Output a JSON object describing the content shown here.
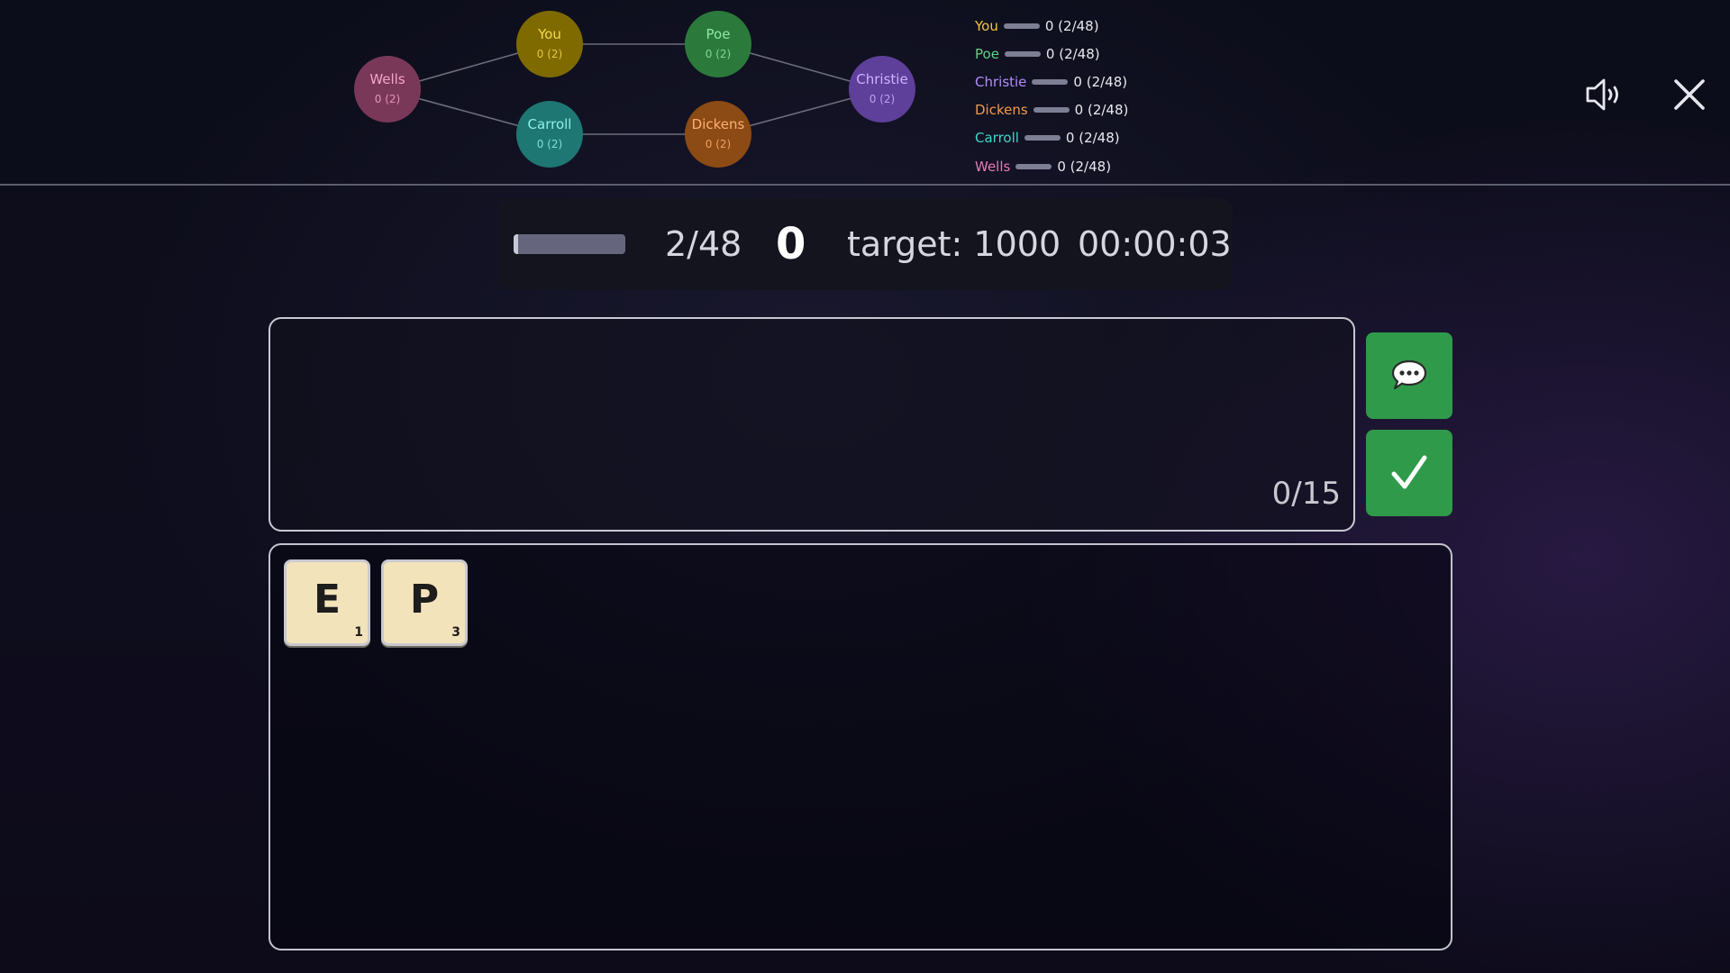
{
  "network": {
    "nodes": [
      {
        "id": "you",
        "name": "You",
        "score": "0 (2)",
        "fill": "#7f6a00",
        "text": "#f6d84a"
      },
      {
        "id": "poe",
        "name": "Poe",
        "score": "0 (2)",
        "fill": "#2b7a3b",
        "text": "#8ee7a3"
      },
      {
        "id": "christie",
        "name": "Christie",
        "score": "0 (2)",
        "fill": "#5e3f9a",
        "text": "#cfb4ff"
      },
      {
        "id": "dickens",
        "name": "Dickens",
        "score": "0 (2)",
        "fill": "#8c4a14",
        "text": "#ffb072"
      },
      {
        "id": "carroll",
        "name": "Carroll",
        "score": "0 (2)",
        "fill": "#1e7773",
        "text": "#8ef0e6"
      },
      {
        "id": "wells",
        "name": "Wells",
        "score": "0 (2)",
        "fill": "#7a3858",
        "text": "#f3a3cb"
      }
    ],
    "edge_color": "#6b6d7c"
  },
  "leaderboard": [
    {
      "name": "You",
      "value": "0 (2/48)",
      "color": "#f4c542"
    },
    {
      "name": "Poe",
      "value": "0 (2/48)",
      "color": "#5fd38a"
    },
    {
      "name": "Christie",
      "value": "0 (2/48)",
      "color": "#b48dfb"
    },
    {
      "name": "Dickens",
      "value": "0 (2/48)",
      "color": "#f39a4e"
    },
    {
      "name": "Carroll",
      "value": "0 (2/48)",
      "color": "#3fd5c9"
    },
    {
      "name": "Wells",
      "value": "0 (2/48)",
      "color": "#e779b6"
    }
  ],
  "header": {
    "sound_icon": "speaker-volume-icon",
    "close_icon": "close-x-icon"
  },
  "status": {
    "progress_fraction": 0.04,
    "count": "2/48",
    "score": "0",
    "target": "target: 1000",
    "timer": "00:00:03"
  },
  "word": {
    "count": "0/15"
  },
  "buttons": {
    "chat_icon": "speech-bubble-icon",
    "submit_icon": "checkmark-icon",
    "color": "#2f9a4a"
  },
  "rack": {
    "tiles": [
      {
        "letter": "E",
        "points": "1"
      },
      {
        "letter": "P",
        "points": "3"
      }
    ]
  }
}
